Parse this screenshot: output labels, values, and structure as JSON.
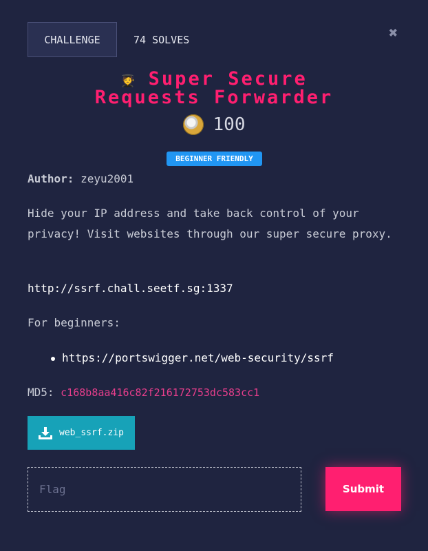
{
  "tabs": {
    "challenge": "CHALLENGE",
    "solves": "74 SOLVES"
  },
  "close_icon": "close-icon",
  "title": {
    "emoji": "🧑‍🎓",
    "text_line1": "Super Secure",
    "text_line2": "Requests Forwarder"
  },
  "points": {
    "icon": "coin-icon",
    "value": "100"
  },
  "badge": "BEGINNER FRIENDLY",
  "author": {
    "label": "Author:",
    "name": "zeyu2001"
  },
  "description": "Hide your IP address and take back control of your privacy! Visit websites through our super secure proxy.",
  "url": "http://ssrf.chall.seetf.sg:1337",
  "for_beginners": "For beginners:",
  "links": [
    "https://portswigger.net/web-security/ssrf"
  ],
  "md5": {
    "label": "MD5:",
    "value": "c168b8aa416c82f216172753dc583cc1"
  },
  "download": {
    "icon": "download-icon",
    "label": "web_ssrf.zip"
  },
  "flag": {
    "placeholder": "Flag",
    "value": ""
  },
  "submit": "Submit",
  "colors": {
    "background": "#1f2440",
    "accent_pink": "#ff1f70",
    "badge_blue": "#2196f3",
    "download_teal": "#17a2b8",
    "md5_pink": "#e83e8c"
  }
}
